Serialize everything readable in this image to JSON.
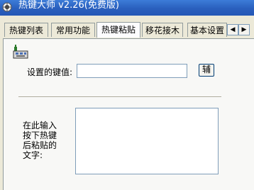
{
  "window": {
    "title": "热键大师 v2.26(免费版)"
  },
  "tabs": [
    {
      "label": "热键列表"
    },
    {
      "label": "常用功能"
    },
    {
      "label": "热键粘贴"
    },
    {
      "label": "移花接木"
    },
    {
      "label": "基本设置"
    }
  ],
  "form": {
    "hotkey_label": "设置的键值:",
    "hotkey_value": "",
    "hotkey_button": "辅",
    "text_label": "在此输入\n按下热键\n后粘贴的\n文字:",
    "text_value": ""
  }
}
